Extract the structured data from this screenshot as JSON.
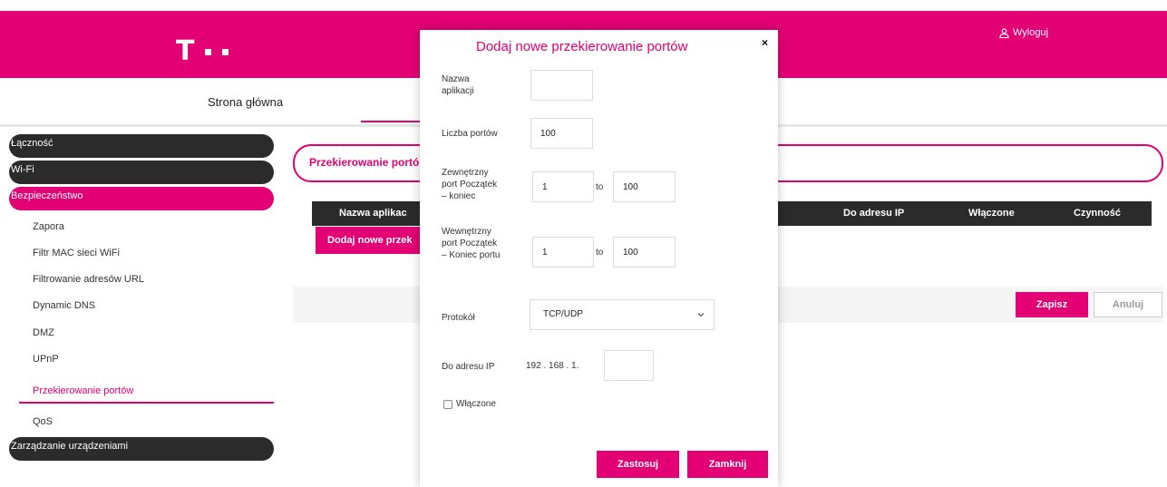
{
  "header": {
    "logo_text": "T",
    "logout_label": "Wyloguj"
  },
  "nav": {
    "home_label": "Strona główna"
  },
  "sidebar": {
    "items": [
      {
        "label": "Łączność"
      },
      {
        "label": "Wi-Fi"
      },
      {
        "label": "Bezpieczeństwo"
      },
      {
        "label": "Zarządzanie urządzeniami"
      }
    ],
    "subitems": [
      {
        "label": "Zapora"
      },
      {
        "label": "Filtr MAC sieci WiFi"
      },
      {
        "label": "Filtrowanie adresów URL"
      },
      {
        "label": "Dynamic DNS"
      },
      {
        "label": "DMZ"
      },
      {
        "label": "UPnP"
      },
      {
        "label": "Przekierowanie portów"
      },
      {
        "label": "QoS"
      }
    ]
  },
  "main": {
    "section_title": "Przekierowanie portó",
    "table_headers": [
      "Nazwa aplikac",
      "Do adresu IP",
      "Włączone",
      "Czynność"
    ],
    "add_button": "Dodaj nowe przek",
    "save_button": "Zapisz",
    "cancel_button": "Anuluj"
  },
  "modal": {
    "title": "Dodaj nowe przekierowanie portów",
    "close": "×",
    "app_name_label": "Nazwa aplikacji",
    "app_name_value": "",
    "port_count_label": "Liczba portów",
    "port_count_value": "100",
    "external_label": "Zewnętrzny port Początek – koniec",
    "external_start": "1",
    "external_end": "100",
    "internal_label": "Wewnętrzny port Początek – Koniec portu",
    "internal_start": "1",
    "internal_end": "100",
    "to_label": "to",
    "protocol_label": "Protokół",
    "protocol_value": "TCP/UDP",
    "ip_label": "Do adresu IP",
    "ip_prefix": "192 . 168 . 1.",
    "ip_last": "",
    "enabled_label": "Włączone",
    "apply_button": "Zastosuj",
    "close_button": "Zamknij"
  },
  "colors": {
    "brand": "#e20074",
    "dark": "#2b2b2b"
  }
}
